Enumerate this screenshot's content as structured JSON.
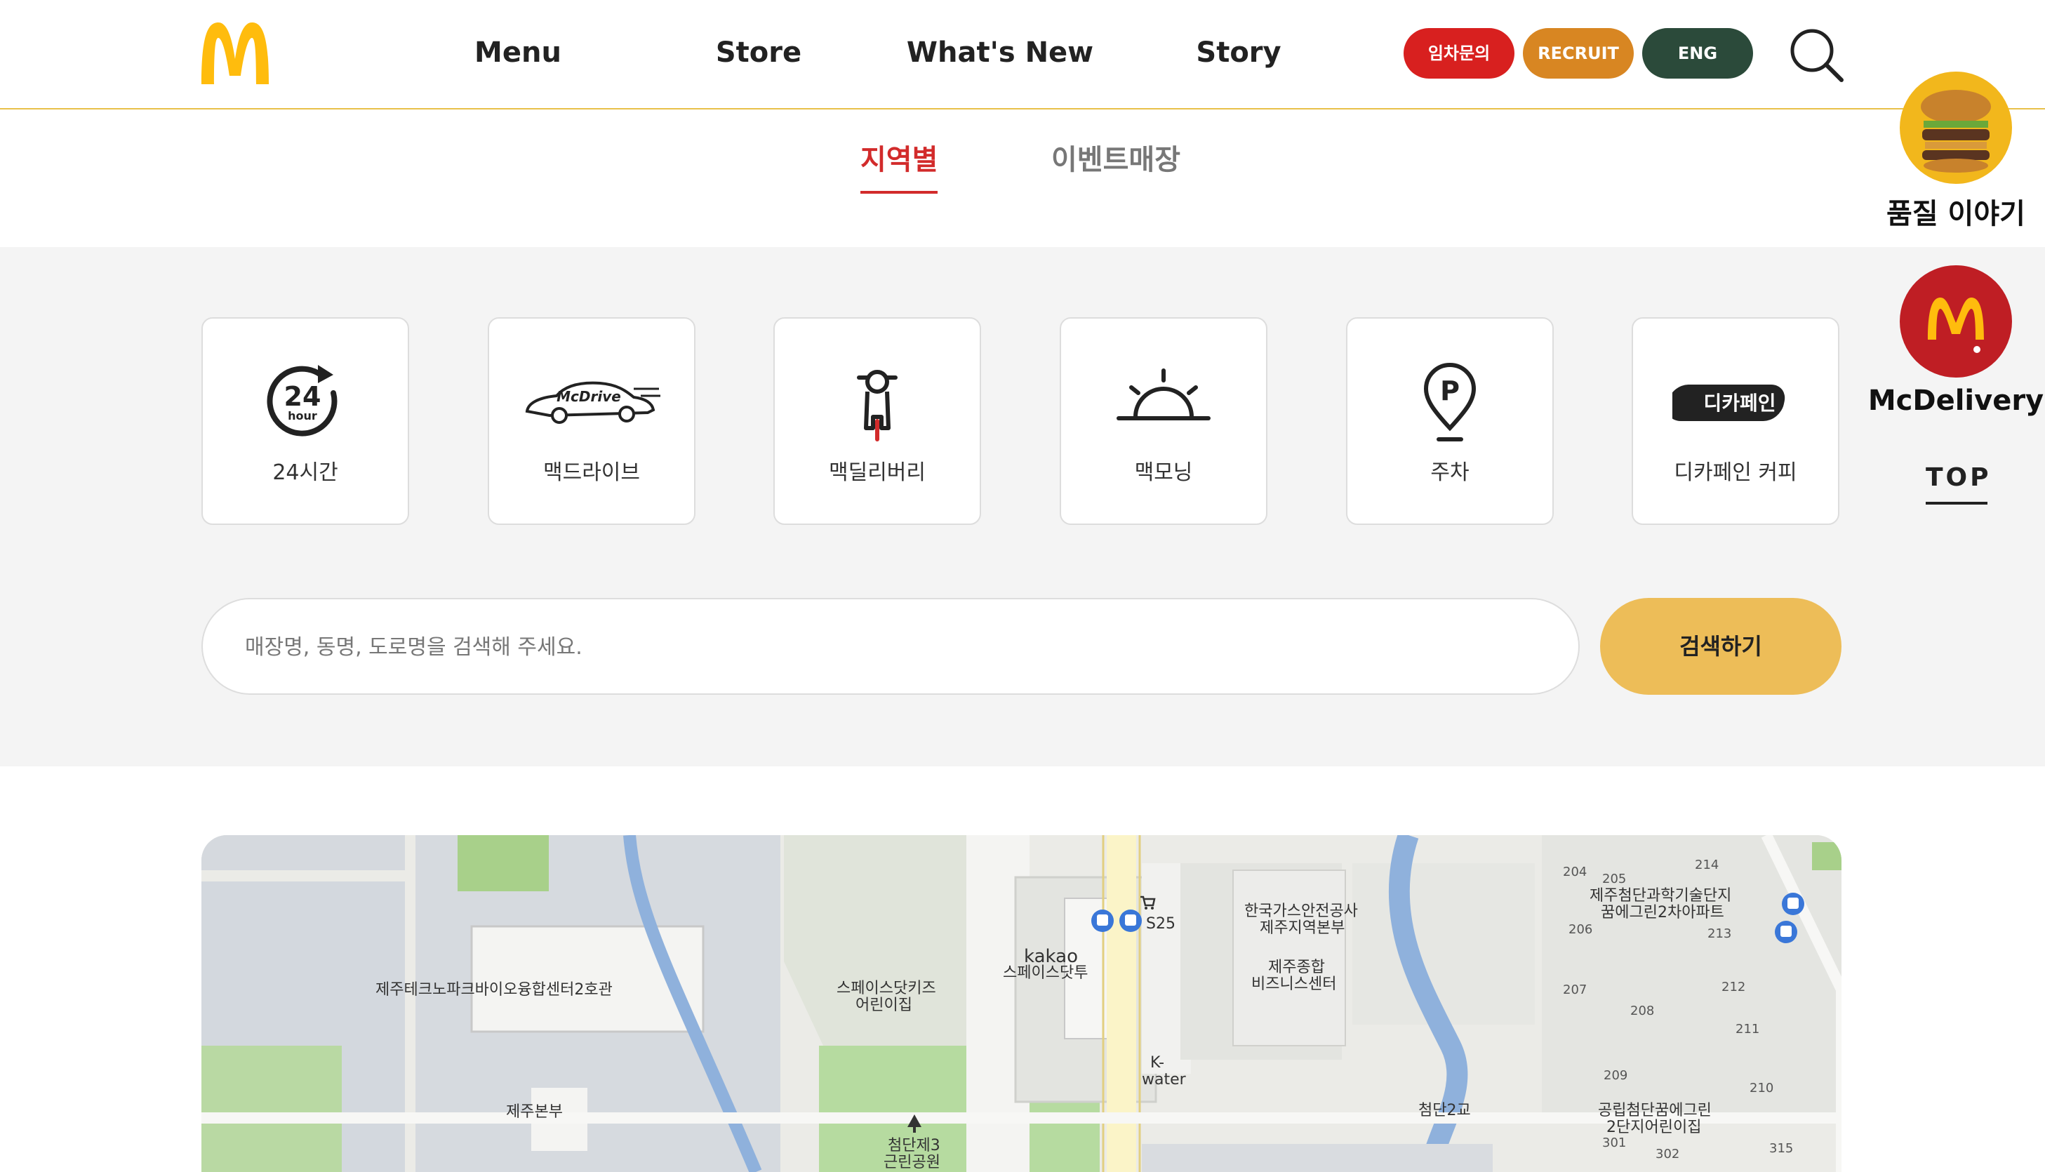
{
  "header": {
    "nav": [
      "Menu",
      "Store",
      "What's New",
      "Story"
    ],
    "pills": [
      {
        "label": "임차문의",
        "color": "#d8201f"
      },
      {
        "label": "RECRUIT",
        "color": "#d88622"
      },
      {
        "label": "ENG",
        "color": "#2b4a3a"
      }
    ],
    "brand_color": "#ffbc0d"
  },
  "subtabs": [
    {
      "label": "지역별",
      "active": true
    },
    {
      "label": "이벤트매장",
      "active": false
    }
  ],
  "filters": [
    {
      "label": "24시간",
      "icon": "24-hour-icon"
    },
    {
      "label": "맥드라이브",
      "icon": "mcdrive-car-icon"
    },
    {
      "label": "맥딜리버리",
      "icon": "scooter-icon"
    },
    {
      "label": "맥모닝",
      "icon": "sunrise-icon"
    },
    {
      "label": "주차",
      "icon": "parking-pin-icon"
    },
    {
      "label": "디카페인 커피",
      "icon": "decaf-logo-icon"
    }
  ],
  "filter_icon_text": {
    "hours": "24",
    "hour_sub": "hour",
    "mcdrive": "McDrive",
    "parking": "P",
    "decaf": "디카페인"
  },
  "search": {
    "placeholder": "매장명, 동명, 도로명을 검색해 주세요.",
    "button": "검색하기"
  },
  "map": {
    "labels": {
      "biocenter": "제주테크노파크바이오융합센터2호관",
      "jejubonbu": "제주본부",
      "kids_1": "스페이스닷키즈",
      "kids_2": "어린이집",
      "kakao_1": "kakao",
      "kakao_2": "스페이스닷투",
      "s25": "S25",
      "kgs_1": "한국가스안전공사",
      "kgs_2": "제주지역본부",
      "biz_1": "제주종합",
      "biz_2": "비즈니스센터",
      "kwater_1": "K-",
      "kwater_2": "water",
      "park_1": "첨단제3",
      "park_2": "근린공원",
      "bridge": "첨단2교",
      "apt_1": "제주첨단과학기술단지",
      "apt_2": "꿈에그린2차아파트",
      "daycare_1": "공립첨단꿈에그린",
      "daycare_2": "2단지어린이집"
    },
    "numbers": [
      "204",
      "205",
      "214",
      "206",
      "213",
      "207",
      "212",
      "208",
      "211",
      "209",
      "210",
      "301",
      "302",
      "315"
    ]
  },
  "side": {
    "quality": "품질 이야기",
    "delivery": "McDelivery",
    "top": "TOP"
  }
}
